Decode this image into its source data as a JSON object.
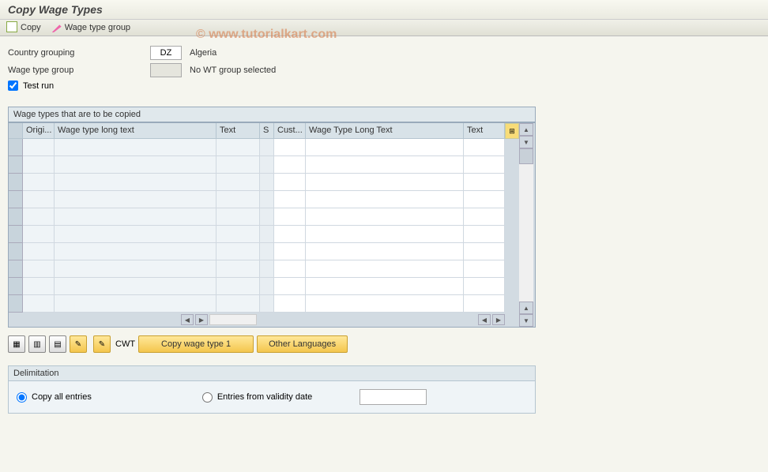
{
  "titleBar": {
    "title": "Copy Wage Types"
  },
  "toolbar": {
    "copy_label": "Copy",
    "wage_type_group_label": "Wage type group"
  },
  "watermark": "© www.tutorialkart.com",
  "form": {
    "country_grouping_label": "Country grouping",
    "country_grouping_value": "DZ",
    "country_grouping_text": "Algeria",
    "wage_type_group_label": "Wage type group",
    "wage_type_group_value": "",
    "wage_type_group_text": "No WT group selected",
    "test_run_label": "Test run",
    "test_run_checked": true
  },
  "table": {
    "title": "Wage types that are to be copied",
    "columns": {
      "origi": "Origi...",
      "longtext": "Wage type long text",
      "text": "Text",
      "s": "S",
      "cust": "Cust...",
      "longtext2": "Wage Type Long Text",
      "text2": "Text"
    },
    "rows": [
      {
        "origi": "",
        "longtext": "",
        "text": "",
        "s": "",
        "cust": "",
        "longtext2": "",
        "text2": ""
      },
      {
        "origi": "",
        "longtext": "",
        "text": "",
        "s": "",
        "cust": "",
        "longtext2": "",
        "text2": ""
      },
      {
        "origi": "",
        "longtext": "",
        "text": "",
        "s": "",
        "cust": "",
        "longtext2": "",
        "text2": ""
      },
      {
        "origi": "",
        "longtext": "",
        "text": "",
        "s": "",
        "cust": "",
        "longtext2": "",
        "text2": ""
      },
      {
        "origi": "",
        "longtext": "",
        "text": "",
        "s": "",
        "cust": "",
        "longtext2": "",
        "text2": ""
      },
      {
        "origi": "",
        "longtext": "",
        "text": "",
        "s": "",
        "cust": "",
        "longtext2": "",
        "text2": ""
      },
      {
        "origi": "",
        "longtext": "",
        "text": "",
        "s": "",
        "cust": "",
        "longtext2": "",
        "text2": ""
      },
      {
        "origi": "",
        "longtext": "",
        "text": "",
        "s": "",
        "cust": "",
        "longtext2": "",
        "text2": ""
      },
      {
        "origi": "",
        "longtext": "",
        "text": "",
        "s": "",
        "cust": "",
        "longtext2": "",
        "text2": ""
      },
      {
        "origi": "",
        "longtext": "",
        "text": "",
        "s": "",
        "cust": "",
        "longtext2": "",
        "text2": ""
      }
    ]
  },
  "actions": {
    "cwt_label": "CWT",
    "copy_wage_type_1_label": "Copy wage type 1",
    "other_languages_label": "Other Languages"
  },
  "delimitation": {
    "section_label": "Delimitation",
    "copy_all_label": "Copy all entries",
    "entries_from_label": "Entries from validity date",
    "selected": "copy_all",
    "date_value": ""
  }
}
